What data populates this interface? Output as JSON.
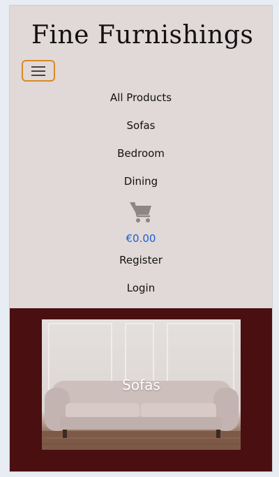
{
  "brand": {
    "title": "Fine Furnishings"
  },
  "nav": {
    "toggler_icon": "hamburger-menu-icon",
    "items": [
      {
        "label": "All Products"
      },
      {
        "label": "Sofas"
      },
      {
        "label": "Bedroom"
      },
      {
        "label": "Dining"
      }
    ],
    "cart": {
      "icon": "shopping-cart-icon",
      "total": "€0.00"
    },
    "account": [
      {
        "label": "Register"
      },
      {
        "label": "Login"
      }
    ]
  },
  "hero": {
    "category_label": "Sofas"
  },
  "colors": {
    "header_bg": "#e1d8d8",
    "hero_bg": "#4a0f10",
    "toggler_border": "#d98a21",
    "price_text": "#1b5fcf"
  }
}
